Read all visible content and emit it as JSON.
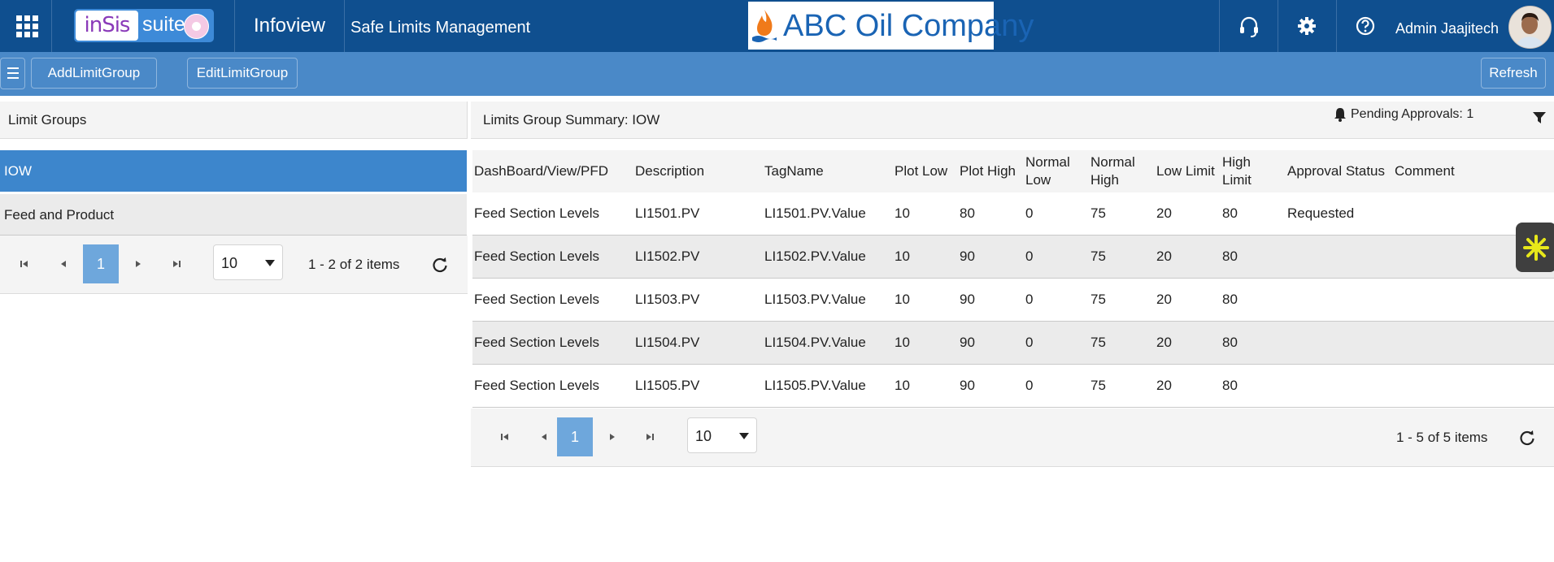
{
  "topbar": {
    "logo_insis": "inSis",
    "logo_suite": "suite",
    "app_name": "Infoview",
    "page_title": "Safe Limits Management",
    "company": "ABC Oil Company",
    "user_name": "Admin Jaajitech",
    "colors": {
      "bar": "#0f4f8f",
      "toolbar": "#4a89c8",
      "selected": "#3d86cc"
    }
  },
  "toolbar": {
    "add_label": "AddLimitGroup",
    "edit_label": "EditLimitGroup",
    "refresh_label": "Refresh"
  },
  "left_panel": {
    "title": "Limit Groups",
    "items": [
      {
        "label": "IOW",
        "selected": true
      },
      {
        "label": "Feed and Product",
        "selected": false
      }
    ],
    "pager": {
      "page": "1",
      "page_size": "10",
      "info": "1 - 2 of 2 items"
    }
  },
  "right_panel": {
    "title": "Limits Group Summary: IOW",
    "pending": "Pending Approvals: 1",
    "columns": [
      "DashBoard/View/PFD",
      "Description",
      "TagName",
      "Plot Low",
      "Plot High",
      "Normal Low",
      "Normal High",
      "Low Limit",
      "High Limit",
      "Approval Status",
      "Comment"
    ],
    "rows": [
      [
        "Feed Section Levels",
        "LI1501.PV",
        "LI1501.PV.Value",
        "10",
        "80",
        "0",
        "75",
        "20",
        "80",
        "Requested",
        ""
      ],
      [
        "Feed Section Levels",
        "LI1502.PV",
        "LI1502.PV.Value",
        "10",
        "90",
        "0",
        "75",
        "20",
        "80",
        "",
        ""
      ],
      [
        "Feed Section Levels",
        "LI1503.PV",
        "LI1503.PV.Value",
        "10",
        "90",
        "0",
        "75",
        "20",
        "80",
        "",
        ""
      ],
      [
        "Feed Section Levels",
        "LI1504.PV",
        "LI1504.PV.Value",
        "10",
        "90",
        "0",
        "75",
        "20",
        "80",
        "",
        ""
      ],
      [
        "Feed Section Levels",
        "LI1505.PV",
        "LI1505.PV.Value",
        "10",
        "90",
        "0",
        "75",
        "20",
        "80",
        "",
        ""
      ]
    ],
    "pager": {
      "page": "1",
      "page_size": "10",
      "info": "1 - 5 of 5 items"
    }
  },
  "icons": [
    "apps-grid-icon",
    "headset-icon",
    "gear-icon",
    "help-icon",
    "hamburger-icon",
    "bell-icon",
    "filter-icon",
    "refresh-icon",
    "first-page-icon",
    "prev-page-icon",
    "next-page-icon",
    "last-page-icon",
    "asterisk-icon"
  ]
}
